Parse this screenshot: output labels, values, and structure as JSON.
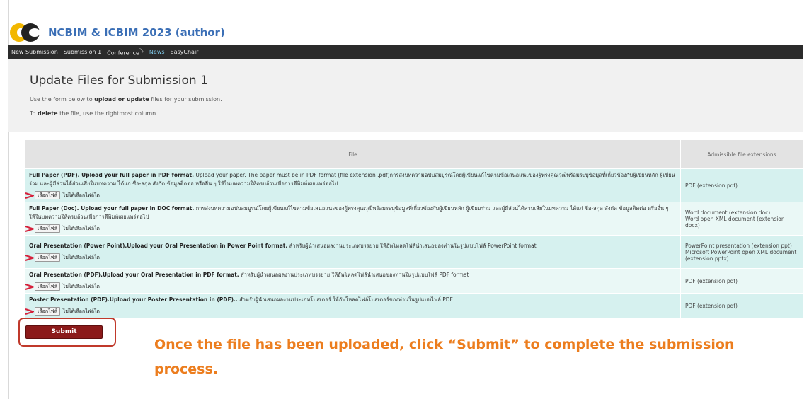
{
  "header": {
    "app_title": "NCBIM & ICBIM 2023 (author)",
    "logo_icon": "easychair-logo-icon"
  },
  "nav": {
    "items": [
      {
        "label": "New Submission",
        "active": false
      },
      {
        "label": "Submission 1",
        "active": false
      },
      {
        "label": "Conference",
        "active": false,
        "suffix": "⤵"
      },
      {
        "label": "News",
        "active": true
      },
      {
        "label": "EasyChair",
        "active": false
      }
    ]
  },
  "page": {
    "title": "Update Files for Submission 1",
    "help1_pre": "Use the form below to ",
    "help1_bold": "upload or update",
    "help1_post": " files for your submission.",
    "help2_pre": "To ",
    "help2_bold": "delete",
    "help2_post": " the file, use the rightmost column."
  },
  "table": {
    "col_file": "File",
    "col_ext": "Admissible file extensions",
    "choose_label": "เลือกไฟล์",
    "no_file_label": "ไม่ได้เลือกไฟล์ใด",
    "rows": [
      {
        "name": "Full Paper (PDF). Upload your full paper in PDF format.",
        "desc": " Upload your paper. The paper must be in PDF format (file extension .pdf)การส่งบทความฉบับสมบูรณ์โดยผู้เขียนแก้ไขตามข้อเสนอแนะของผู้ทรงคุณวุฒิพร้อมระบุข้อมูลที่เกี่ยวข้องกับผู้เขียนหลัก ผู้เขียนร่วม และผู้มีส่วนได้ส่วนเสียในบทความ ได้แก่ ชื่อ-สกุล สังกัด ข้อมูลติดต่อ หรืออื่น ๆ ให้ในบทความให้ครบถ้วนเพื่อการตีพิมพ์เผยแพร่ต่อไป",
        "ext": "PDF (extension pdf)"
      },
      {
        "name": "Full Paper (Doc). Upload your full paper in DOC format.",
        "desc": " การส่งบทความฉบับสมบูรณ์โดยผู้เขียนแก้ไขตามข้อเสนอแนะของผู้ทรงคุณวุฒิพร้อมระบุข้อมูลที่เกี่ยวข้องกับผู้เขียนหลัก ผู้เขียนร่วม และผู้มีส่วนได้ส่วนเสียในบทความ ได้แก่ ชื่อ-สกุล สังกัด ข้อมูลติดต่อ หรืออื่น ๆ ให้ในบทความให้ครบถ้วนเพื่อการตีพิมพ์เผยแพร่ต่อไป",
        "ext": "Word document (extension doc)\nWord open XML document (extension docx)"
      },
      {
        "name": "Oral Presentation (Power Point).Upload your Oral Presentation in Power Point format.",
        "desc": " สำหรับผู้นำเสนอผลงานประเภทบรรยาย ให้อัพโหลดไฟล์นำเสนอของท่านในรูปแบบไฟล์ PowerPoint format",
        "ext": "PowerPoint presentation (extension ppt)\nMicrosoft PowerPoint open XML document (extension pptx)"
      },
      {
        "name": "Oral Presentation (PDF).Upload your Oral Presentation in PDF format.",
        "desc": " สำหรับผู้นำเสนอผลงานประเภทบรรยาย ให้อัพโหลดไฟล์นำเสนอของท่านในรูปแบบไฟล์ PDF format",
        "ext": "PDF (extension pdf)"
      },
      {
        "name": "Poster Presentation (PDF).Upload your Poster Presentation in (PDF)..",
        "desc": " สำหรับผู้นำเสนอผลงานประเภทโปสเตอร์ ให้อัพโหลดไฟล์โปสเตอร์ของท่านในรูปแบบไฟล์ PDF",
        "ext": "PDF (extension pdf)"
      }
    ]
  },
  "submit": {
    "label": "Submit"
  },
  "callout": {
    "text": "Once the file has been uploaded, click “Submit” to complete the submission process."
  },
  "colors": {
    "nav_bg": "#2b2b2b",
    "accent": "#3b6fb6",
    "row_a": "#d6f1ef",
    "row_b": "#eaf8f6",
    "submit_bg": "#8b1a1a",
    "callout": "#ec7d1e",
    "highlight": "#c0392b"
  }
}
